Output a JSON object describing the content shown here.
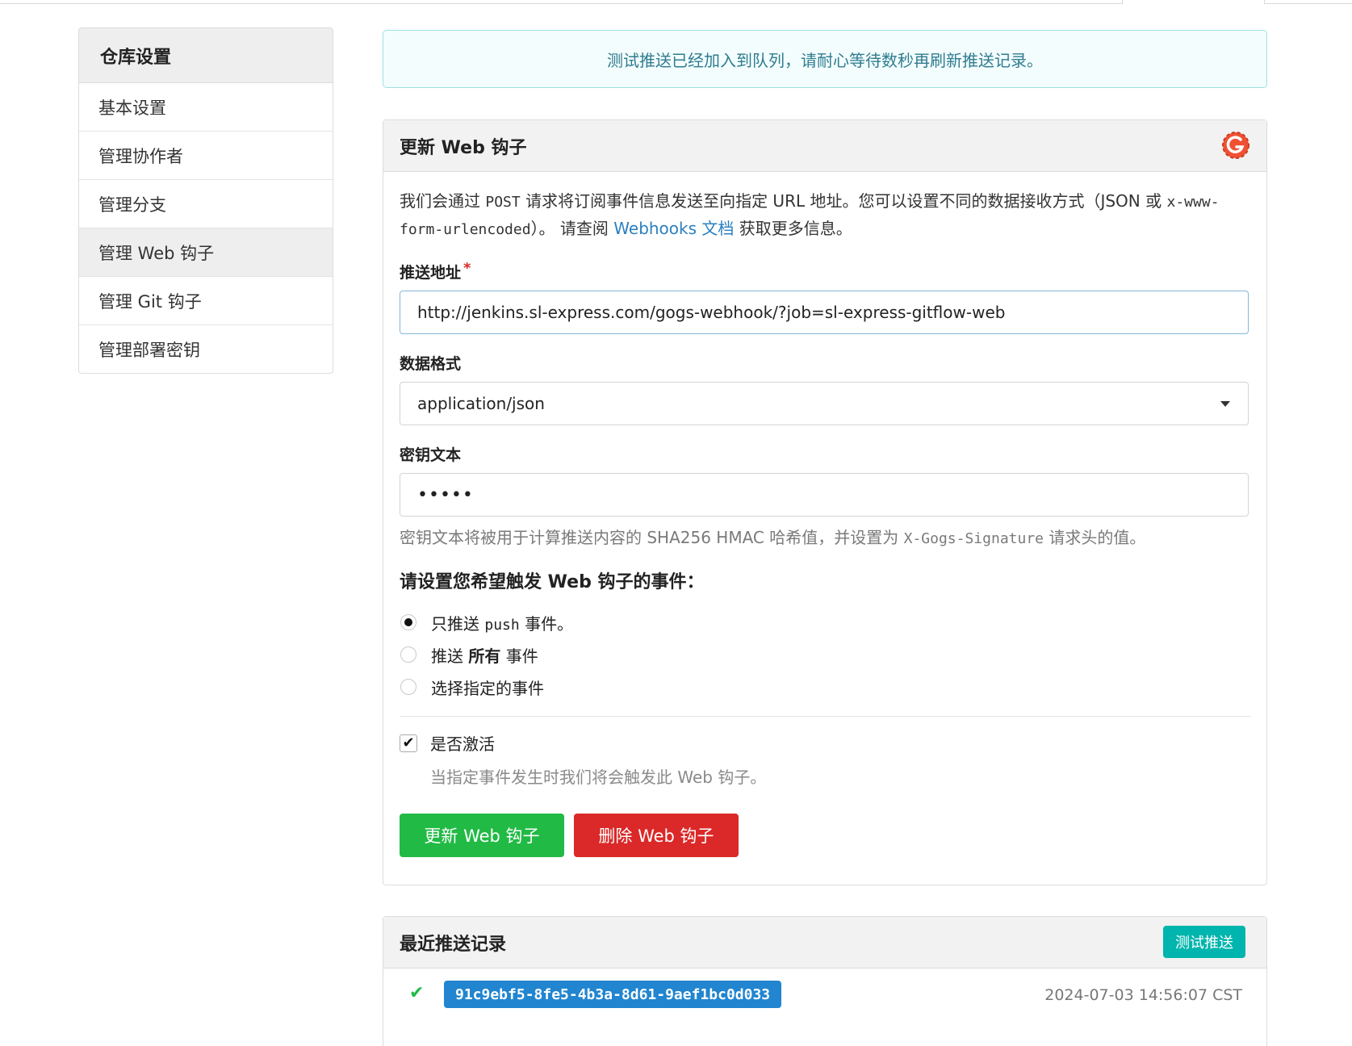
{
  "notice": "测试推送已经加入到队列，请耐心等待数秒再刷新推送记录。",
  "sidebar": {
    "title": "仓库设置",
    "items": [
      {
        "label": "基本设置"
      },
      {
        "label": "管理协作者"
      },
      {
        "label": "管理分支"
      },
      {
        "label": "管理 Web 钩子"
      },
      {
        "label": "管理 Git 钩子"
      },
      {
        "label": "管理部署密钥"
      }
    ]
  },
  "form": {
    "title": "更新 Web 钩子",
    "logo_icon": "gogs-icon",
    "desc": {
      "p1": "我们会通过 ",
      "post": "POST",
      "p2": " 请求将订阅事件信息发送至向指定 URL 地址。您可以设置不同的数据接收方式（JSON 或 ",
      "form_encoded": "x-www-form-urlencoded",
      "p3": "）。 请查阅 ",
      "link": "Webhooks 文档",
      "p4": " 获取更多信息。"
    },
    "url_label": "推送地址",
    "required_mark": "*",
    "url_value": "http://jenkins.sl-express.com/gogs-webhook/?job=sl-express-gitflow-web",
    "content_type_label": "数据格式",
    "content_type_value": "application/json",
    "secret_label": "密钥文本",
    "secret_value": "•••••",
    "secret_help": {
      "p1": "密钥文本将被用于计算推送内容的 SHA256 HMAC 哈希值，并设置为 ",
      "header": "X-Gogs-Signature",
      "p2": " 请求头的值。"
    },
    "events_title": "请设置您希望触发 Web 钩子的事件：",
    "events": {
      "push_only": {
        "p1": "只推送 ",
        "code": "push",
        "p2": " 事件。",
        "checked": true
      },
      "all": {
        "p1": "推送 ",
        "bold": "所有",
        "p2": " 事件",
        "checked": false
      },
      "choose": {
        "label": "选择指定的事件",
        "checked": false
      }
    },
    "active_label": "是否激活",
    "active_checked": true,
    "active_help": "当指定事件发生时我们将会触发此 Web 钩子。",
    "update_button": "更新 Web 钩子",
    "delete_button": "删除 Web 钩子"
  },
  "history": {
    "title": "最近推送记录",
    "test_button": "测试推送",
    "rows": [
      {
        "status": "✔",
        "uuid": "91c9ebf5-8fe5-4b3a-8d61-9aef1bc0d033",
        "time": "2024-07-03 14:56:07 CST"
      }
    ]
  },
  "colors": {
    "accent_green": "#21ba45",
    "accent_red": "#db2828",
    "accent_teal": "#00b5ad",
    "accent_blue": "#2185d0",
    "link_blue": "#2b7fbf",
    "notice_text": "#2f7c8f"
  }
}
